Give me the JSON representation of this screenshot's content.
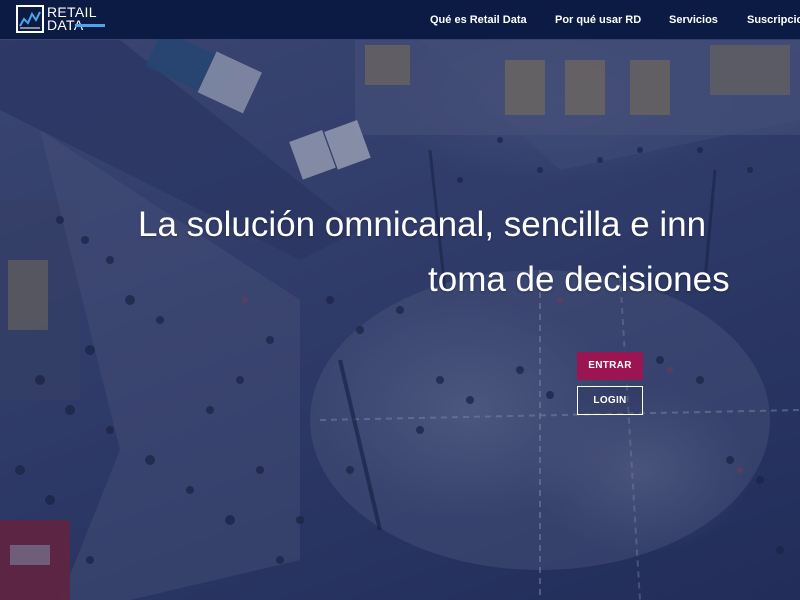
{
  "brand": {
    "line1": "RETAIL",
    "line2": "DATA",
    "accent_color": "#4fa3e8"
  },
  "nav": {
    "items": [
      {
        "label": "Qué es Retail Data"
      },
      {
        "label": "Por qué usar RD"
      },
      {
        "label": "Servicios"
      },
      {
        "label": "Suscripcion"
      }
    ]
  },
  "hero": {
    "headline_line1": "La solución omnicanal, sencilla e inn",
    "headline_line2": "toma de decisiones",
    "entrar_label": "ENTRAR",
    "login_label": "LOGIN",
    "entrar_color": "#9c1553",
    "navbar_color": "#0c1b44"
  }
}
